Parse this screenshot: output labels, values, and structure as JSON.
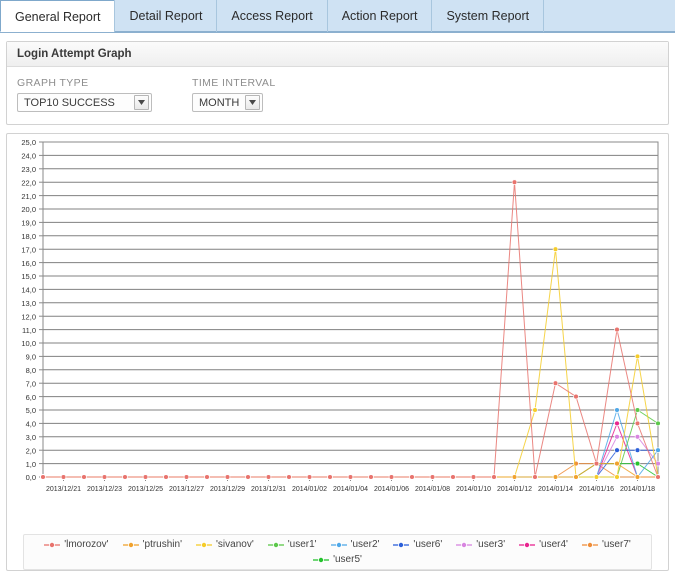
{
  "tabs": [
    {
      "label": "General Report",
      "active": true
    },
    {
      "label": "Detail Report",
      "active": false
    },
    {
      "label": "Access Report",
      "active": false
    },
    {
      "label": "Action Report",
      "active": false
    },
    {
      "label": "System Report",
      "active": false
    }
  ],
  "panel": {
    "title": "Login Attempt Graph",
    "graph_type": {
      "label": "GRAPH TYPE",
      "value": "TOP10 SUCCESS"
    },
    "time_interval": {
      "label": "TIME INTERVAL",
      "value": "MONTH"
    }
  },
  "chart_data": {
    "type": "line",
    "title": "",
    "xlabel": "",
    "ylabel": "",
    "ylim": [
      0,
      25
    ],
    "ytick_labels": [
      "0,0",
      "1,0",
      "2,0",
      "3,0",
      "4,0",
      "5,0",
      "6,0",
      "7,0",
      "8,0",
      "9,0",
      "10,0",
      "11,0",
      "12,0",
      "13,0",
      "14,0",
      "15,0",
      "16,0",
      "17,0",
      "18,0",
      "19,0",
      "20,0",
      "21,0",
      "22,0",
      "23,0",
      "24,0",
      "25,0"
    ],
    "grid": true,
    "legend_position": "bottom",
    "x": [
      "2013/12/20",
      "2013/12/21",
      "2013/12/22",
      "2013/12/23",
      "2013/12/24",
      "2013/12/25",
      "2013/12/26",
      "2013/12/27",
      "2013/12/28",
      "2013/12/29",
      "2013/12/30",
      "2013/12/31",
      "2014/01/01",
      "2014/01/02",
      "2014/01/03",
      "2014/01/04",
      "2014/01/05",
      "2014/01/06",
      "2014/01/07",
      "2014/01/08",
      "2014/01/09",
      "2014/01/10",
      "2014/01/11",
      "2014/01/12",
      "2014/01/13",
      "2014/01/14",
      "2014/01/15",
      "2014/01/16",
      "2014/01/17",
      "2014/01/18",
      "2014/01/19"
    ],
    "xtick_labels": [
      "2013/12/21",
      "2013/12/23",
      "2013/12/25",
      "2013/12/27",
      "2013/12/29",
      "2013/12/31",
      "2014/01/02",
      "2014/01/04",
      "2014/01/06",
      "2014/01/08",
      "2014/01/10",
      "2014/01/12",
      "2014/01/14",
      "2014/01/16",
      "2014/01/18"
    ],
    "series": [
      {
        "name": "'lmorozov'",
        "color": "#e8736d",
        "values": [
          0,
          0,
          0,
          0,
          0,
          0,
          0,
          0,
          0,
          0,
          0,
          0,
          0,
          0,
          0,
          0,
          0,
          0,
          0,
          0,
          0,
          0,
          0,
          22,
          0,
          7,
          6,
          1,
          11,
          4,
          0
        ]
      },
      {
        "name": "'ptrushin'",
        "color": "#f0a22e",
        "values": [
          0,
          0,
          0,
          0,
          0,
          0,
          0,
          0,
          0,
          0,
          0,
          0,
          0,
          0,
          0,
          0,
          0,
          0,
          0,
          0,
          0,
          0,
          0,
          0,
          0,
          0,
          0,
          1,
          1,
          0,
          0
        ]
      },
      {
        "name": "'sivanov'",
        "color": "#f5cc2a",
        "values": [
          0,
          0,
          0,
          0,
          0,
          0,
          0,
          0,
          0,
          0,
          0,
          0,
          0,
          0,
          0,
          0,
          0,
          0,
          0,
          0,
          0,
          0,
          0,
          0,
          5,
          17,
          0,
          0,
          0,
          9,
          0
        ]
      },
      {
        "name": "'user1'",
        "color": "#5cc84a",
        "values": [
          0,
          0,
          0,
          0,
          0,
          0,
          0,
          0,
          0,
          0,
          0,
          0,
          0,
          0,
          0,
          0,
          0,
          0,
          0,
          0,
          0,
          0,
          0,
          0,
          0,
          0,
          0,
          0,
          0,
          5,
          4
        ]
      },
      {
        "name": "'user2'",
        "color": "#4fa8e8",
        "values": [
          0,
          0,
          0,
          0,
          0,
          0,
          0,
          0,
          0,
          0,
          0,
          0,
          0,
          0,
          0,
          0,
          0,
          0,
          0,
          0,
          0,
          0,
          0,
          0,
          0,
          0,
          0,
          0,
          5,
          0,
          2
        ]
      },
      {
        "name": "'user6'",
        "color": "#2b5fd9",
        "values": [
          0,
          0,
          0,
          0,
          0,
          0,
          0,
          0,
          0,
          0,
          0,
          0,
          0,
          0,
          0,
          0,
          0,
          0,
          0,
          0,
          0,
          0,
          0,
          0,
          0,
          0,
          0,
          0,
          2,
          2,
          2
        ]
      },
      {
        "name": "'user3'",
        "color": "#d885e0",
        "values": [
          0,
          0,
          0,
          0,
          0,
          0,
          0,
          0,
          0,
          0,
          0,
          0,
          0,
          0,
          0,
          0,
          0,
          0,
          0,
          0,
          0,
          0,
          0,
          0,
          0,
          0,
          0,
          0,
          3,
          3,
          1
        ]
      },
      {
        "name": "'user4'",
        "color": "#e8258f",
        "values": [
          0,
          0,
          0,
          0,
          0,
          0,
          0,
          0,
          0,
          0,
          0,
          0,
          0,
          0,
          0,
          0,
          0,
          0,
          0,
          0,
          0,
          0,
          0,
          0,
          0,
          0,
          0,
          0,
          4,
          0,
          0
        ]
      },
      {
        "name": "'user7'",
        "color": "#ef8e3a",
        "values": [
          0,
          0,
          0,
          0,
          0,
          0,
          0,
          0,
          0,
          0,
          0,
          0,
          0,
          0,
          0,
          0,
          0,
          0,
          0,
          0,
          0,
          0,
          0,
          0,
          0,
          0,
          1,
          1,
          0,
          0,
          0
        ]
      },
      {
        "name": "'user5'",
        "color": "#25c22e",
        "values": [
          0,
          0,
          0,
          0,
          0,
          0,
          0,
          0,
          0,
          0,
          0,
          0,
          0,
          0,
          0,
          0,
          0,
          0,
          0,
          0,
          0,
          0,
          0,
          0,
          0,
          0,
          0,
          1,
          1,
          1,
          0
        ]
      }
    ]
  }
}
